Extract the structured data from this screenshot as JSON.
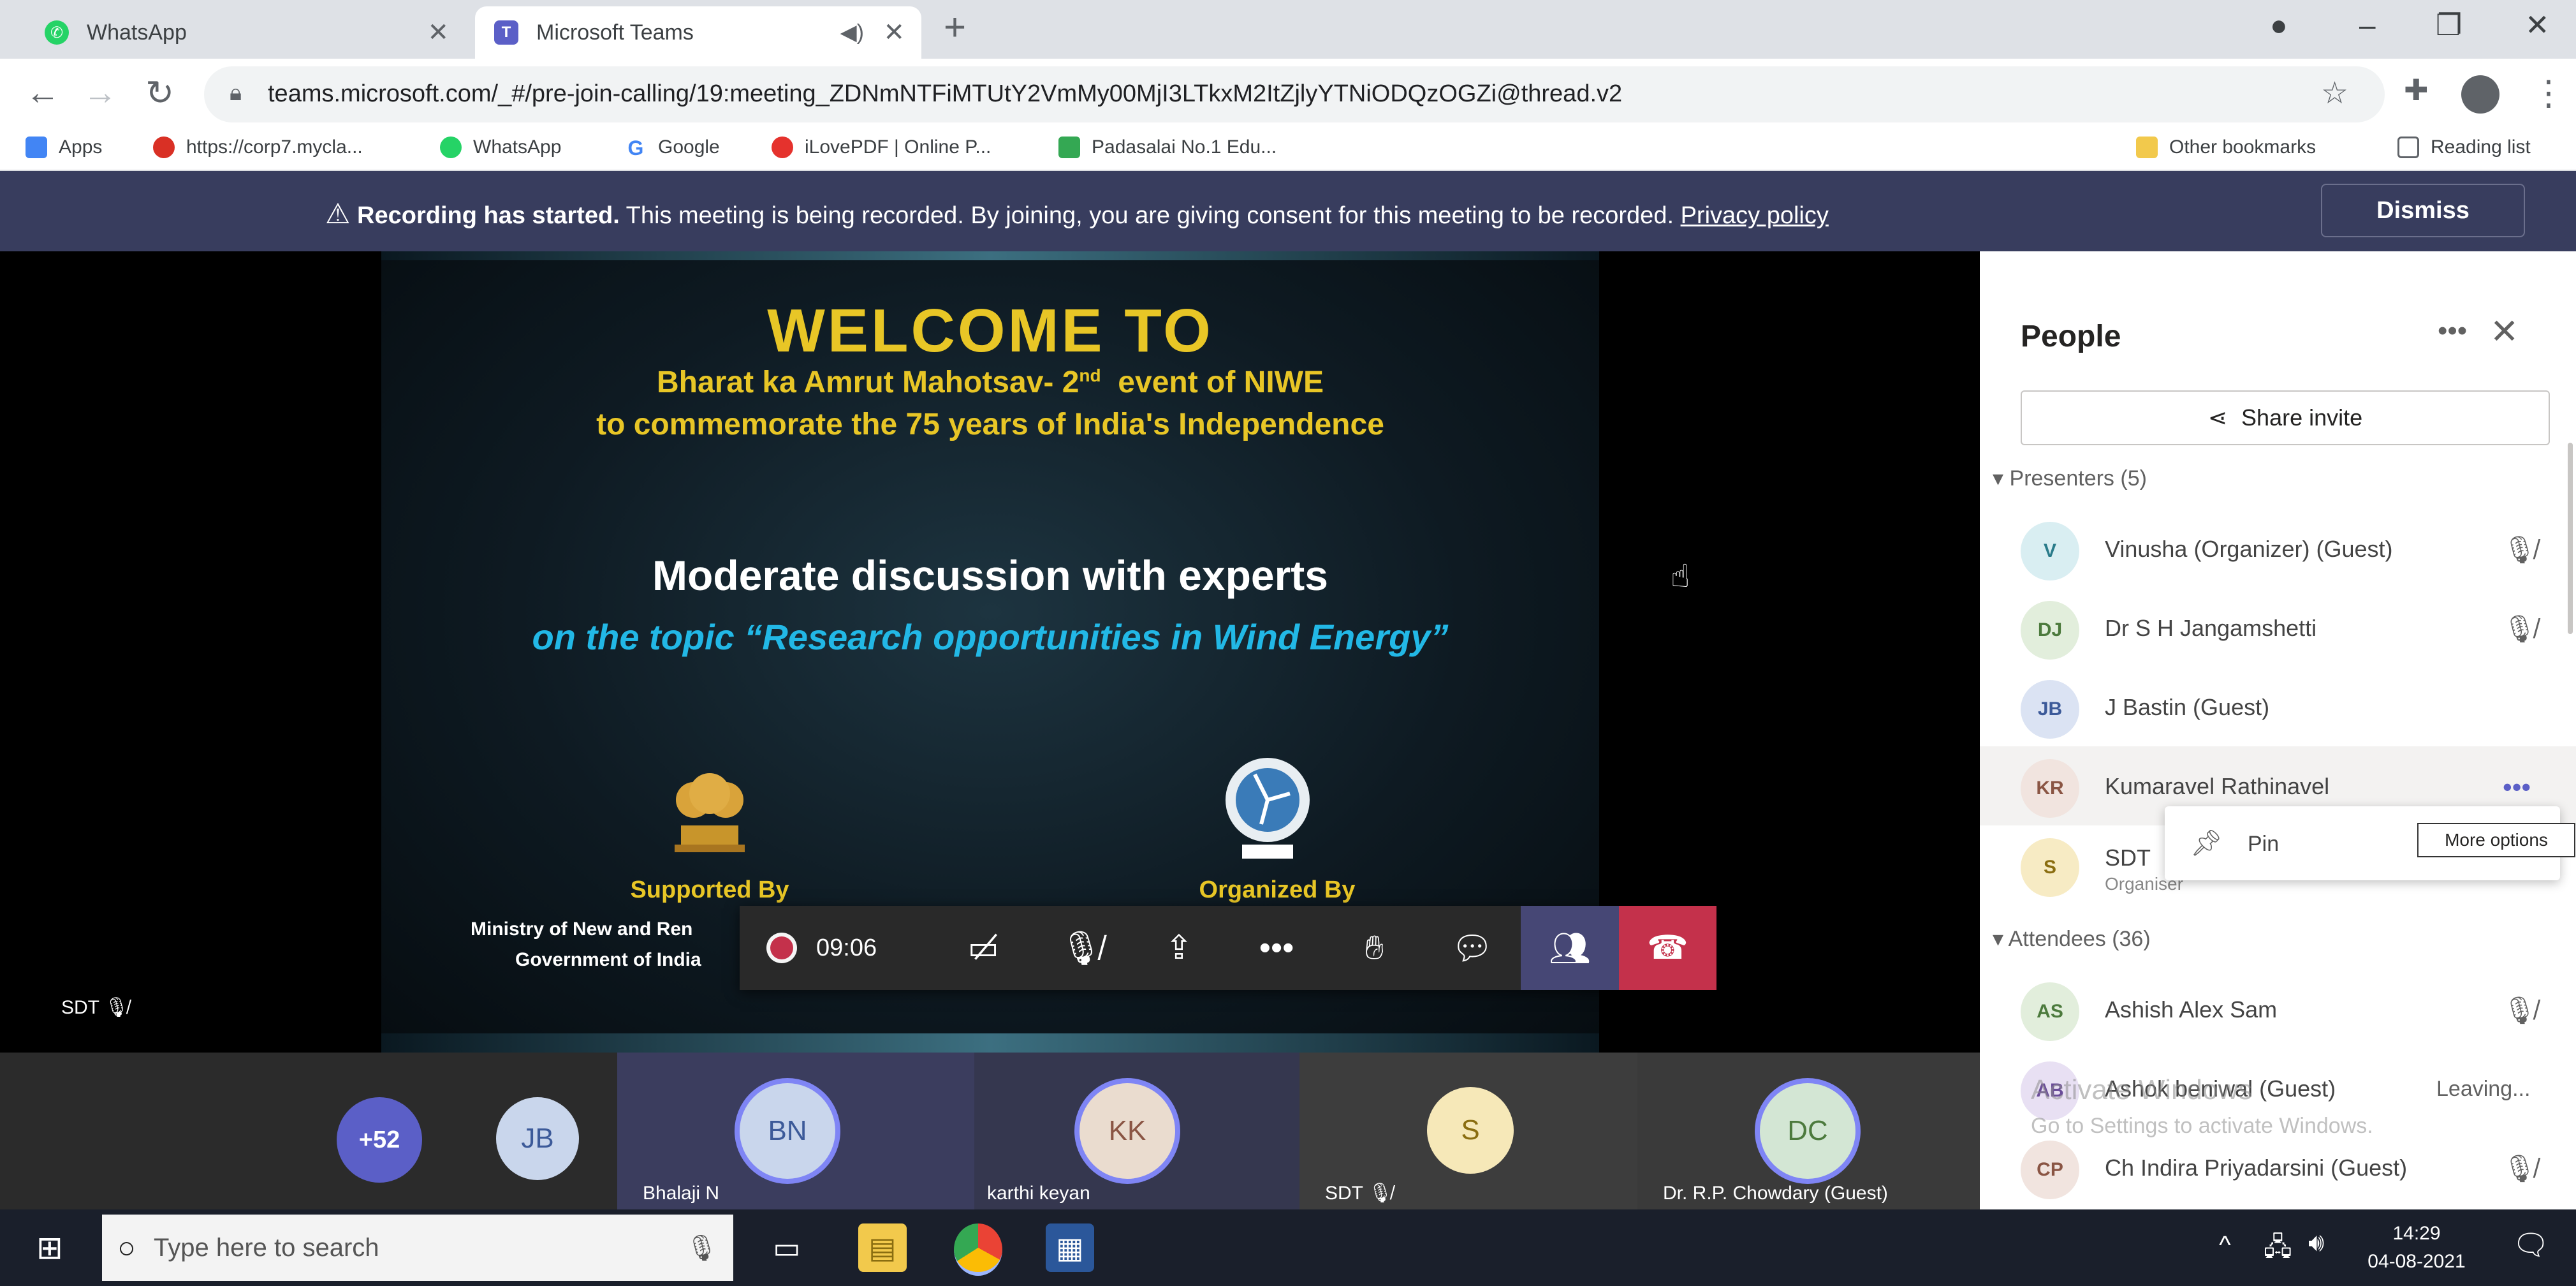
{
  "browser": {
    "tabs": [
      {
        "title": "WhatsApp",
        "icon": "whatsapp-icon"
      },
      {
        "title": "Microsoft Teams",
        "icon": "teams-icon"
      }
    ],
    "url": "teams.microsoft.com/_#/pre-join-calling/19:meeting_ZDNmNTFiMTUtY2VmMy00MjI3LTkxM2ItZjlyYTNiODQzOGZi@thread.v2",
    "bookmarks": [
      {
        "label": "Apps",
        "icon": "apps-grid-icon",
        "color": "#4285f4"
      },
      {
        "label": "https://corp7.mycla...",
        "icon": "corp-site-icon",
        "color": "#d93025"
      },
      {
        "label": "WhatsApp",
        "icon": "whatsapp-icon",
        "color": "#25d366"
      },
      {
        "label": "Google",
        "icon": "google-icon",
        "color": "#4285f4"
      },
      {
        "label": "iLovePDF | Online P...",
        "icon": "ilovepdf-icon",
        "color": "#e5322d"
      },
      {
        "label": "Padasalai No.1 Edu...",
        "icon": "padasalai-icon",
        "color": "#34a853"
      }
    ],
    "other_bookmarks": "Other bookmarks",
    "reading_list": "Reading list"
  },
  "banner": {
    "bold": "Recording has started.",
    "text": "This meeting is being recorded. By joining, you are giving consent for this meeting to be recorded.",
    "link": "Privacy policy",
    "dismiss": "Dismiss"
  },
  "slide": {
    "welcome": "WELCOME TO",
    "line1_pre": "Bharat ka Amrut Mahotsav- 2",
    "line1_sup": "nd",
    "line1_post": "  event of NIWE",
    "line2": "to commemorate the 75 years of India's Independence",
    "heading": "Moderate discussion with experts",
    "topic": "on the topic “Research opportunities in Wind Energy”",
    "supported_by": "Supported By",
    "organized_by": "Organized By",
    "ministry_line1": "Ministry of New and Ren",
    "ministry_line2": "Government of India"
  },
  "stage": {
    "speaker_label": "SDT"
  },
  "controls": {
    "timer": "09:06"
  },
  "gallery": [
    {
      "initials": "+52",
      "name": "",
      "bg": "#5b5fc7"
    },
    {
      "initials": "JB",
      "name": "",
      "bg": "#c9d6ec"
    },
    {
      "initials": "BN",
      "name": "Bhalaji N",
      "bg": "#c9d6ec"
    },
    {
      "initials": "KK",
      "name": "karthi keyan",
      "bg": "#eadccf"
    },
    {
      "initials": "S",
      "name": "SDT",
      "bg": "#f6e8b8"
    },
    {
      "initials": "DC",
      "name": "Dr. R.P. Chowdary (Guest)",
      "bg": "#d3e6d4"
    }
  ],
  "panel": {
    "title": "People",
    "share_invite": "Share invite",
    "presenters_header": "Presenters (5)",
    "attendees_header": "Attendees (36)",
    "presenters": [
      {
        "initials": "V",
        "name": "Vinusha (Organizer) (Guest)",
        "bg": "#d9eef2",
        "fg": "#2a7b8a",
        "muted": true
      },
      {
        "initials": "DJ",
        "name": "Dr S H Jangamshetti",
        "bg": "#e2eedc",
        "fg": "#4c7a3d",
        "muted": true
      },
      {
        "initials": "JB",
        "name": "J Bastin (Guest)",
        "bg": "#dbe3f3",
        "fg": "#3c5a99",
        "muted": false
      },
      {
        "initials": "KR",
        "name": "Kumaravel Rathinavel",
        "bg": "#f1e4df",
        "fg": "#8a5544",
        "muted": false
      },
      {
        "initials": "S",
        "name": "SDT",
        "sub": "Organiser",
        "bg": "#f7ebc4",
        "fg": "#8a6d10",
        "muted": false
      }
    ],
    "attendees": [
      {
        "initials": "AS",
        "name": "Ashish Alex Sam",
        "bg": "#e2eedc",
        "fg": "#4c7a3d",
        "muted": true,
        "status": ""
      },
      {
        "initials": "AB",
        "name": "Ashok beniwal (Guest)",
        "bg": "#e8e0f3",
        "fg": "#6a4c99",
        "muted": false,
        "status": "Leaving..."
      },
      {
        "initials": "CP",
        "name": "Ch Indira Priyadarsini (Guest)",
        "bg": "#f1e4df",
        "fg": "#8a5544",
        "muted": true,
        "status": ""
      }
    ],
    "pin": "Pin",
    "more_options": "More options",
    "activate_title": "Activate Windows",
    "activate_sub": "Go to Settings to activate Windows."
  },
  "taskbar": {
    "search_placeholder": "Type here to search",
    "time": "14:29",
    "date": "04-08-2021"
  }
}
